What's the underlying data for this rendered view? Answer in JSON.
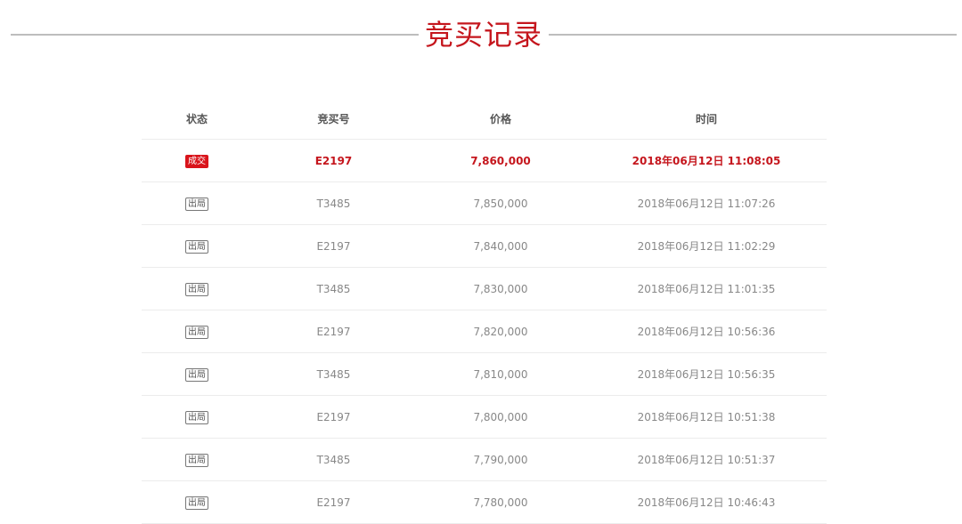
{
  "page": {
    "title": "竞买记录"
  },
  "table": {
    "headers": {
      "status": "状态",
      "code": "竞买号",
      "price": "价格",
      "time": "时间"
    },
    "rows": [
      {
        "status": "成交",
        "code": "E2197",
        "price": "7,860,000",
        "time": "2018年06月12日 11:08:05"
      },
      {
        "status": "出局",
        "code": "T3485",
        "price": "7,850,000",
        "time": "2018年06月12日 11:07:26"
      },
      {
        "status": "出局",
        "code": "E2197",
        "price": "7,840,000",
        "time": "2018年06月12日 11:02:29"
      },
      {
        "status": "出局",
        "code": "T3485",
        "price": "7,830,000",
        "time": "2018年06月12日 11:01:35"
      },
      {
        "status": "出局",
        "code": "E2197",
        "price": "7,820,000",
        "time": "2018年06月12日 10:56:36"
      },
      {
        "status": "出局",
        "code": "T3485",
        "price": "7,810,000",
        "time": "2018年06月12日 10:56:35"
      },
      {
        "status": "出局",
        "code": "E2197",
        "price": "7,800,000",
        "time": "2018年06月12日 10:51:38"
      },
      {
        "status": "出局",
        "code": "T3485",
        "price": "7,790,000",
        "time": "2018年06月12日 10:51:37"
      },
      {
        "status": "出局",
        "code": "E2197",
        "price": "7,780,000",
        "time": "2018年06月12日 10:46:43"
      }
    ]
  },
  "colors": {
    "accent": "#c5161d",
    "deal_badge": "#d9141b",
    "text": "#888888",
    "header_text": "#555555",
    "divider": "#ececec",
    "title_line": "#bdbdbd"
  }
}
